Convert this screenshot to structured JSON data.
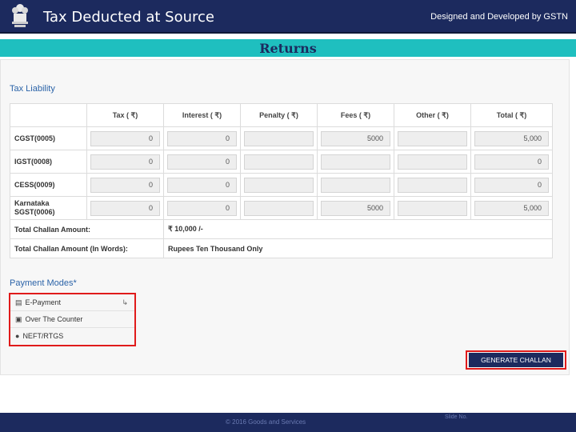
{
  "header": {
    "title": "Tax Deducted at Source",
    "credit": "Designed and Developed by GSTN"
  },
  "band": {
    "title": "Returns"
  },
  "tax_liability": {
    "title": "Tax Liability",
    "columns": [
      "Tax ( ₹)",
      "Interest ( ₹)",
      "Penalty ( ₹)",
      "Fees ( ₹)",
      "Other ( ₹)",
      "Total ( ₹)"
    ],
    "rows": [
      {
        "label": "CGST(0005)",
        "tax": "0",
        "interest": "0",
        "penalty": "",
        "fees": "5000",
        "other": "",
        "total": "5,000"
      },
      {
        "label": "IGST(0008)",
        "tax": "0",
        "interest": "0",
        "penalty": "",
        "fees": "",
        "other": "",
        "total": "0"
      },
      {
        "label": "CESS(0009)",
        "tax": "0",
        "interest": "0",
        "penalty": "",
        "fees": "",
        "other": "",
        "total": "0"
      },
      {
        "label": "Karnataka SGST(0006)",
        "tax": "0",
        "interest": "0",
        "penalty": "",
        "fees": "5000",
        "other": "",
        "total": "5,000"
      }
    ],
    "total_amount_label": "Total Challan Amount:",
    "total_amount_value": "₹ 10,000 /-",
    "total_words_label": "Total Challan Amount (In Words):",
    "total_words_value": "Rupees Ten Thousand Only"
  },
  "payment_modes": {
    "title": "Payment Modes*",
    "items": [
      {
        "label": "E-Payment",
        "icon": "card-icon"
      },
      {
        "label": "Over The Counter",
        "icon": "counter-icon"
      },
      {
        "label": "NEFT/RTGS",
        "icon": "bank-icon"
      }
    ]
  },
  "actions": {
    "generate_label": "GENERATE CHALLAN"
  },
  "footer": {
    "copyright": "© 2016 Goods and Services",
    "page": "Slide No."
  },
  "colors": {
    "header_bg": "#1c2a5e",
    "band_bg": "#1fbfbf",
    "highlight": "#e01b1b",
    "link": "#2b63a8"
  }
}
